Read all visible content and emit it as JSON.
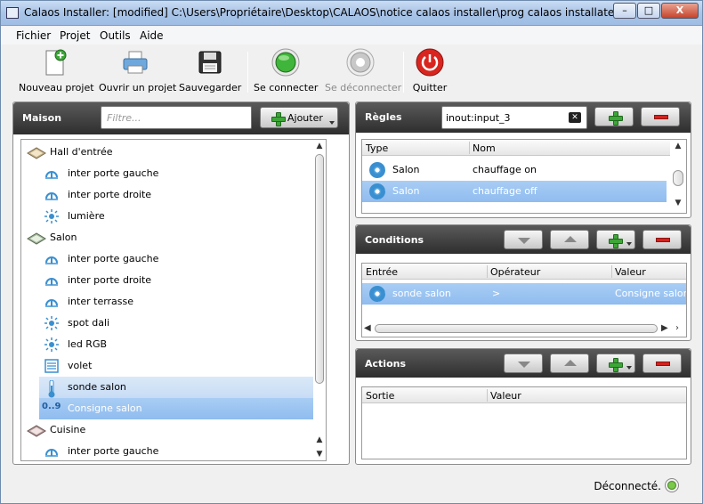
{
  "window": {
    "title": "Calaos Installer: [modified] C:\\Users\\Propriétaire\\Desktop\\CALAOS\\notice calaos installer\\prog calaos installater",
    "minimize": "–",
    "maximize": "□",
    "close": "X"
  },
  "menu": [
    "Fichier",
    "Projet",
    "Outils",
    "Aide"
  ],
  "toolbar": {
    "new_project": "Nouveau projet",
    "open_project": "Ouvrir un projet",
    "save": "Sauvegarder",
    "connect": "Se connecter",
    "disconnect": "Se déconnecter",
    "quit": "Quitter"
  },
  "maison": {
    "title": "Maison",
    "filter_placeholder": "Filtre...",
    "add_label": "Ajouter",
    "tree": [
      {
        "label": "Hall d'entrée",
        "icon": "room-icon",
        "level": 0
      },
      {
        "label": "inter porte gauche",
        "icon": "switch-icon",
        "level": 1
      },
      {
        "label": "inter porte droite",
        "icon": "switch-icon",
        "level": 1
      },
      {
        "label": "lumière",
        "icon": "light-icon",
        "level": 1
      },
      {
        "label": "Salon",
        "icon": "room-icon",
        "level": 0
      },
      {
        "label": "inter porte gauche",
        "icon": "switch-icon",
        "level": 1
      },
      {
        "label": "inter porte droite",
        "icon": "switch-icon",
        "level": 1
      },
      {
        "label": "inter terrasse",
        "icon": "switch-icon",
        "level": 1
      },
      {
        "label": "spot dali",
        "icon": "light-icon",
        "level": 1
      },
      {
        "label": "led RGB",
        "icon": "light-icon",
        "level": 1
      },
      {
        "label": "volet",
        "icon": "shutter-icon",
        "level": 1
      },
      {
        "label": "sonde salon",
        "icon": "thermometer-icon",
        "level": 1
      },
      {
        "label": "Consigne salon",
        "icon": "number-icon",
        "icon_text": "0..9",
        "level": 1
      },
      {
        "label": "Cuisine",
        "icon": "room-icon",
        "level": 0
      },
      {
        "label": "inter porte gauche",
        "icon": "switch-icon",
        "level": 1
      }
    ]
  },
  "regles": {
    "title": "Règles",
    "search_value": "inout:input_3",
    "columns": [
      "Type",
      "Nom"
    ],
    "rows": [
      {
        "type": "Salon",
        "name": "chauffage on"
      },
      {
        "type": "Salon",
        "name": "chauffage off"
      }
    ]
  },
  "conditions": {
    "title": "Conditions",
    "columns": [
      "Entrée",
      "Opérateur",
      "Valeur"
    ],
    "rows": [
      {
        "entree": "sonde salon",
        "operateur": ">",
        "valeur": "Consigne salon"
      }
    ]
  },
  "actions": {
    "title": "Actions",
    "columns": [
      "Sortie",
      "Valeur"
    ]
  },
  "status": {
    "text": "Déconnecté."
  },
  "colors": {
    "header_dark": "#2e2e2e",
    "selection": "#8fbcef",
    "add_green": "#3da638",
    "remove_red": "#d5211d"
  }
}
